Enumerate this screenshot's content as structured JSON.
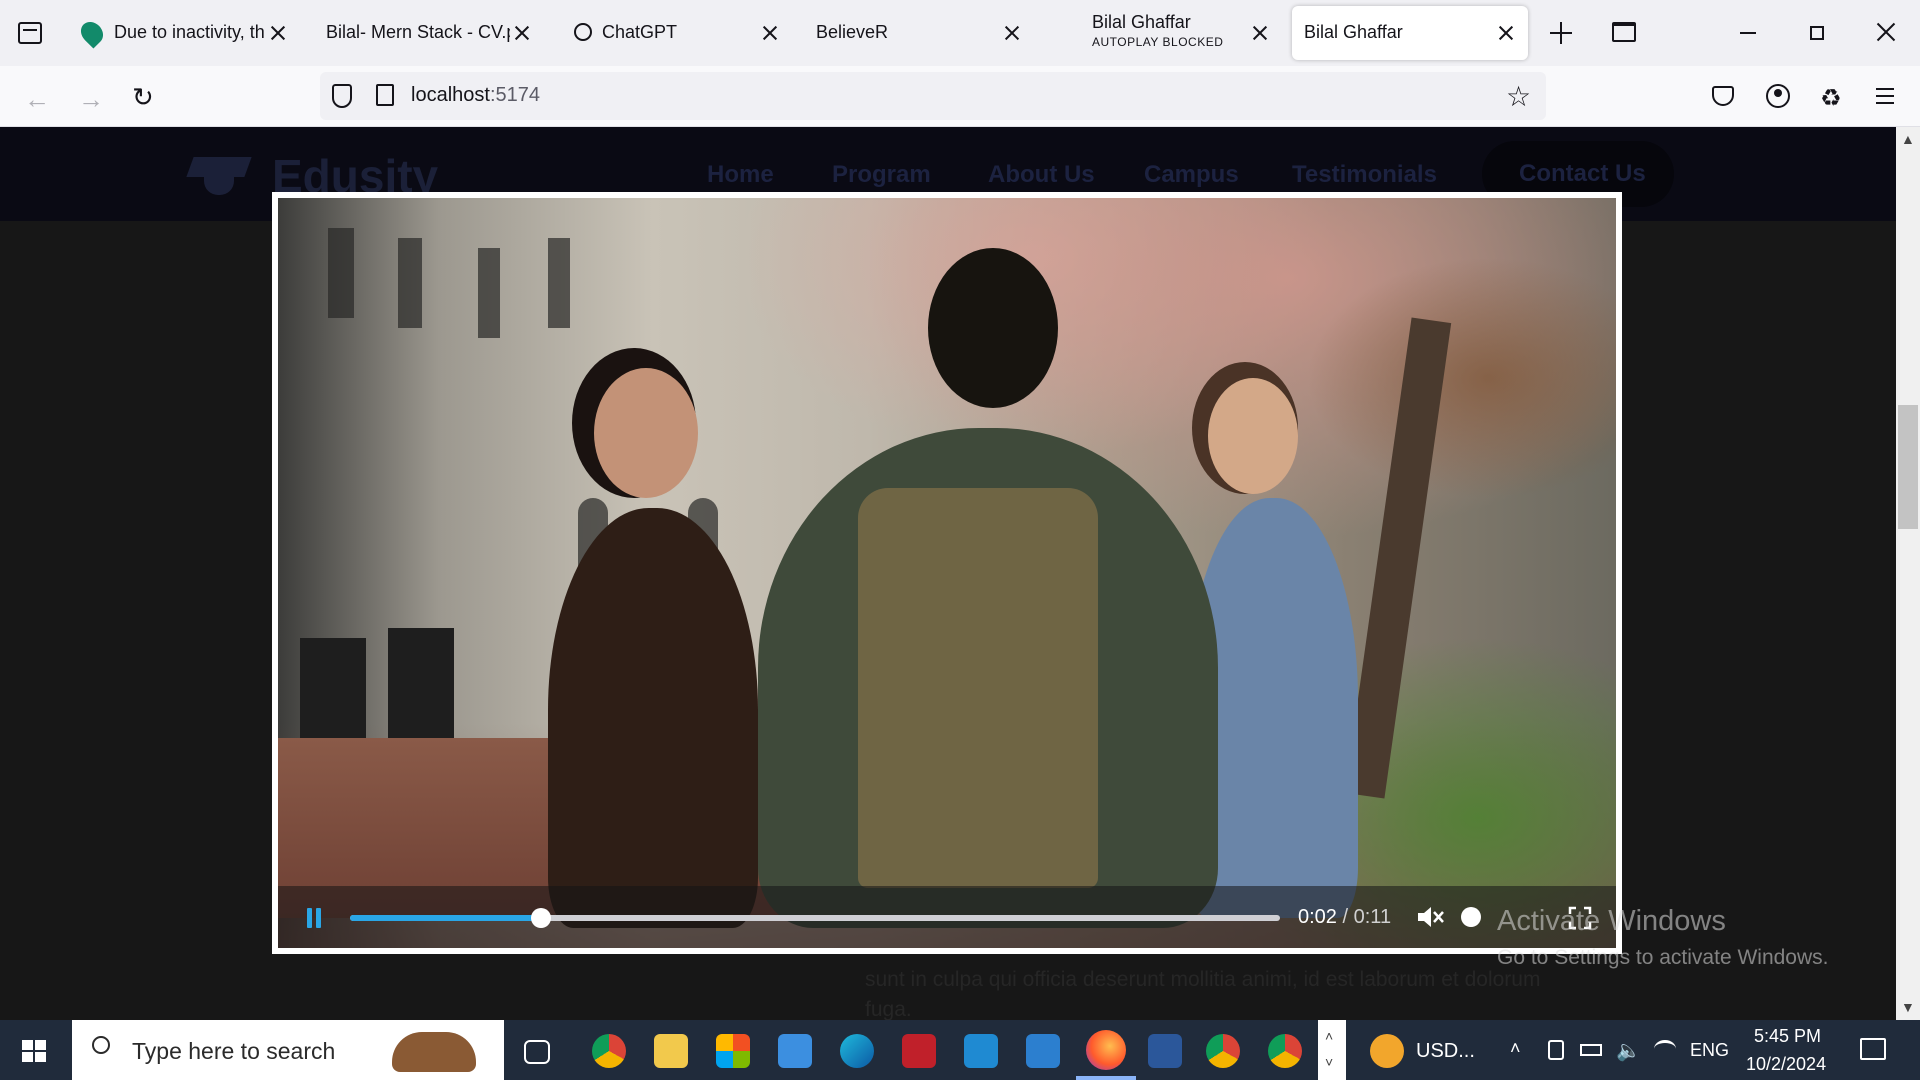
{
  "tabs": [
    {
      "title": "Due to inactivity, the",
      "subtitle": ""
    },
    {
      "title": "Bilal- Mern Stack - CV.p",
      "subtitle": ""
    },
    {
      "title": "ChatGPT",
      "subtitle": ""
    },
    {
      "title": "BelieveR",
      "subtitle": ""
    },
    {
      "title": "Bilal Ghaffar",
      "subtitle": "AUTOPLAY BLOCKED"
    },
    {
      "title": "Bilal Ghaffar",
      "subtitle": ""
    }
  ],
  "address_bar": {
    "host": "localhost",
    "port": ":5174"
  },
  "site": {
    "logo": "Edusity",
    "nav": [
      "Home",
      "Program",
      "About Us",
      "Campus",
      "Testimonials"
    ],
    "contact": "Contact Us",
    "paragraph": "sunt in culpa qui officia deserunt mollitia animi, id est laborum et dolorum fuga."
  },
  "player": {
    "current_time": "0:02",
    "duration": "0:11",
    "progress_fraction": 0.205,
    "muted": true,
    "accent_color": "#2aa6e6"
  },
  "watermark": {
    "line1": "Activate Windows",
    "line2": "Go to Settings to activate Windows."
  },
  "taskbar": {
    "search_placeholder": "Type here to search",
    "currency": "USD...",
    "language": "ENG",
    "time": "5:45 PM",
    "date": "10/2/2024"
  }
}
